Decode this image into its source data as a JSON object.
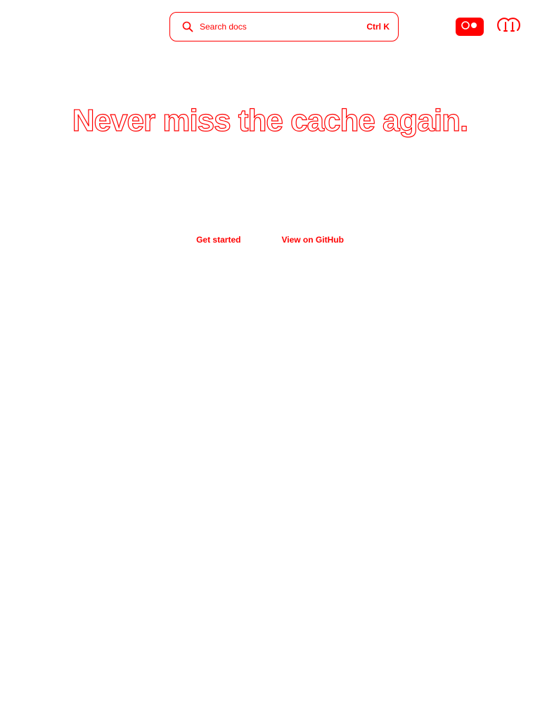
{
  "header": {
    "search": {
      "placeholder": "Search docs",
      "shortcut": "Ctrl K"
    },
    "theme_toggle_icon": "theme-toggle-icon",
    "github_icon": "github-icon"
  },
  "hero": {
    "title": "Never miss the cache again.",
    "primary_cta": "Get started",
    "secondary_cta": "View on GitHub"
  },
  "colors": {
    "accent": "#ff0000",
    "background": "#ffffff"
  }
}
